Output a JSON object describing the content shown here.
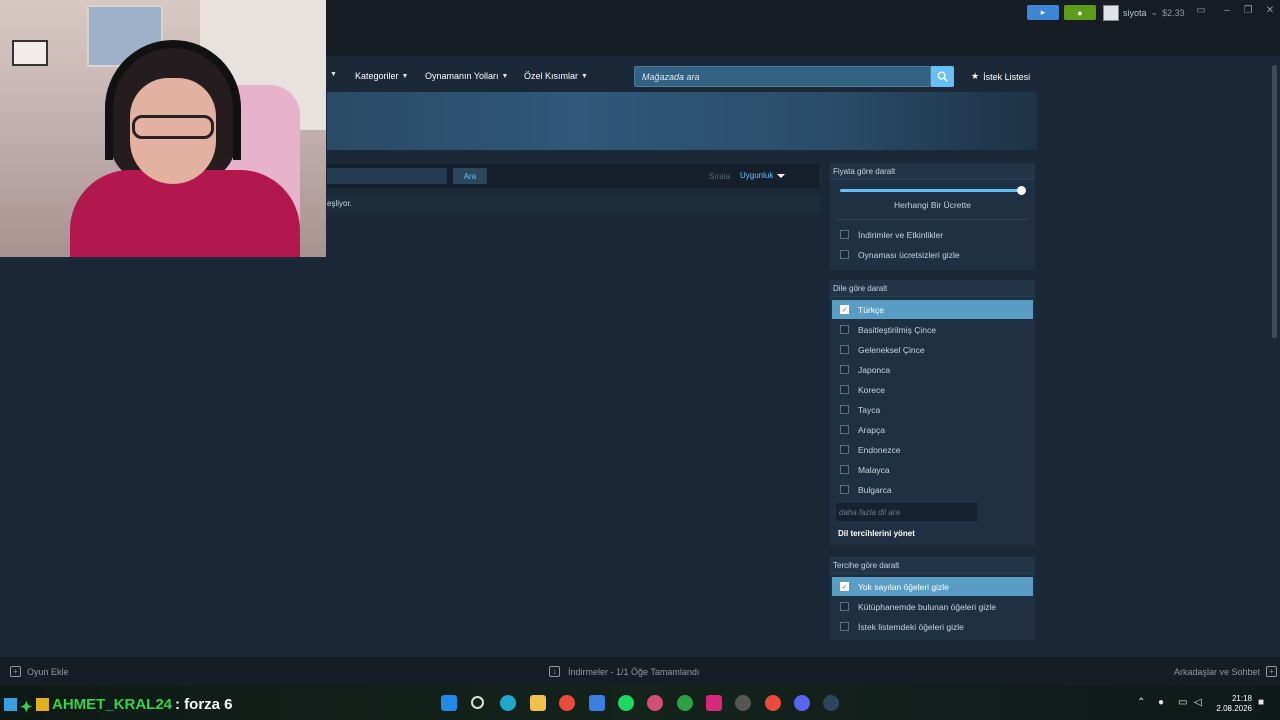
{
  "titlebar": {
    "username": "siyota",
    "balance": "$2.33"
  },
  "storenav": {
    "items": [
      "Kategoriler",
      "Oynamanın Yolları",
      "Özel Kısımlar"
    ],
    "search_placeholder": "Mağazada ara",
    "wishlist": "İstek Listesi"
  },
  "results": {
    "search_button": "Ara",
    "sort_label": "Sırala",
    "sort_value": "Uygunluk",
    "info_text": "eşliyor."
  },
  "filters": {
    "price": {
      "title": "Fiyata göre daralt",
      "price_label": "Herhangi Bir Ücrette",
      "price_level": 1.0,
      "options": [
        {
          "label": "İndirimler ve Etkinlikler",
          "checked": false
        },
        {
          "label": "Oynaması ücretsizleri gizle",
          "checked": false
        }
      ]
    },
    "language": {
      "title": "Dile göre daralt",
      "options": [
        {
          "label": "Türkçe",
          "checked": true
        },
        {
          "label": "Basitleştirilmiş Çince",
          "checked": false
        },
        {
          "label": "Geleneksel Çince",
          "checked": false
        },
        {
          "label": "Japonca",
          "checked": false
        },
        {
          "label": "Korece",
          "checked": false
        },
        {
          "label": "Tayca",
          "checked": false
        },
        {
          "label": "Arapça",
          "checked": false
        },
        {
          "label": "Endonezce",
          "checked": false
        },
        {
          "label": "Malayca",
          "checked": false
        },
        {
          "label": "Bulgarca",
          "checked": false
        }
      ],
      "more_placeholder": "daha fazla dil ara",
      "manage_link": "Dil tercihlerini yönet"
    },
    "preference": {
      "title": "Tercihe göre daralt",
      "options": [
        {
          "label": "Yok sayılan öğeleri gizle",
          "checked": true
        },
        {
          "label": "Kütüphanemde bulunan öğeleri gizle",
          "checked": false
        },
        {
          "label": "İstek listemdeki öğeleri gizle",
          "checked": false
        }
      ]
    }
  },
  "steambar": {
    "add_game": "Oyun Ekle",
    "downloads": "İndirmeler - 1/1 Öğe Tamamlandı",
    "friends": "Arkadaşlar ve Sohbet"
  },
  "overlay": {
    "name": "AHMET_KRAL24",
    "message": ": forza 6"
  },
  "taskbar": {
    "time": "21:18",
    "date": "2.08.2026"
  },
  "colors": {
    "accent": "#66c0f4",
    "background": "#1b2838",
    "checked_row": "#5a9dc4",
    "notification": "#5c9c18"
  }
}
